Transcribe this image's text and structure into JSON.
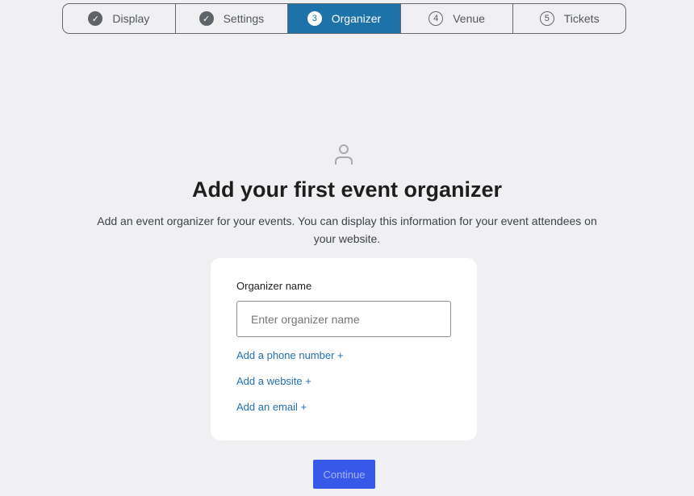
{
  "stepper": {
    "steps": [
      {
        "label": "Display",
        "marker": "✓",
        "state": "completed"
      },
      {
        "label": "Settings",
        "marker": "✓",
        "state": "completed"
      },
      {
        "label": "Organizer",
        "marker": "3",
        "state": "active"
      },
      {
        "label": "Venue",
        "marker": "4",
        "state": "upcoming"
      },
      {
        "label": "Tickets",
        "marker": "5",
        "state": "upcoming"
      }
    ]
  },
  "main": {
    "icon": "person-icon",
    "heading": "Add your first event organizer",
    "description": "Add an event organizer for your events. You can display this information for your event attendees on your website."
  },
  "form": {
    "name_label": "Organizer name",
    "name_placeholder": "Enter organizer name",
    "name_value": "",
    "add_phone": "Add a phone number +",
    "add_website": "Add a website +",
    "add_email": "Add an email +"
  },
  "actions": {
    "continue_label": "Continue"
  },
  "colors": {
    "active_step": "#1d72aa",
    "link": "#2271b1",
    "primary_button": "#3858e9",
    "background": "#f0f0f3"
  }
}
